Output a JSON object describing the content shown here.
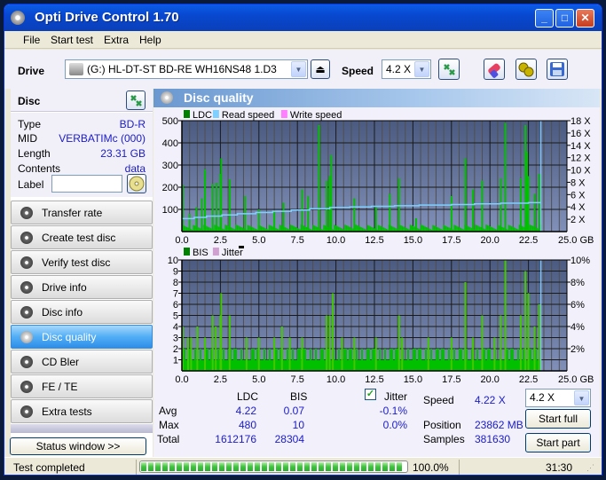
{
  "window": {
    "title": "Opti Drive Control 1.70",
    "controls": [
      "_",
      "□",
      "✕"
    ]
  },
  "menu": [
    "File",
    "Start test",
    "Extra",
    "Help"
  ],
  "toolbar": {
    "drive_label": "Drive",
    "drive_value": "(G:)  HL-DT-ST BD-RE  WH16NS48 1.D3",
    "speed_label": "Speed",
    "speed_value": "4.2 X",
    "icons": [
      "refresh-icon",
      "erase-icon",
      "settings-icon",
      "save-icon"
    ]
  },
  "disc": {
    "header": "Disc",
    "rows": [
      {
        "key": "Type",
        "value": "BD-R"
      },
      {
        "key": "MID",
        "value": "VERBATIMc (000)"
      },
      {
        "key": "Length",
        "value": "23.31 GB"
      },
      {
        "key": "Contents",
        "value": "data"
      }
    ],
    "label_key": "Label",
    "label_value": ""
  },
  "nav": [
    {
      "label": "Transfer rate",
      "active": false
    },
    {
      "label": "Create test disc",
      "active": false
    },
    {
      "label": "Verify test disc",
      "active": false
    },
    {
      "label": "Drive info",
      "active": false
    },
    {
      "label": "Disc info",
      "active": false
    },
    {
      "label": "Disc quality",
      "active": true
    },
    {
      "label": "CD Bler",
      "active": false
    },
    {
      "label": "FE / TE",
      "active": false
    },
    {
      "label": "Extra tests",
      "active": false
    }
  ],
  "status_window_button": "Status window >>",
  "panel_title": "Disc quality",
  "colors": {
    "ldc": "#00c000",
    "bis": "#00c000",
    "read_speed": "#80d0ff",
    "write_speed": "#ff80ff",
    "jitter": "#d0a0d0",
    "plot_bg_top": "#4a5a80",
    "plot_bg_bottom": "#8090b8",
    "value_text": "#1a1acc"
  },
  "chart_data": [
    {
      "type": "bar",
      "title": "LDC / Read speed",
      "legend": [
        "LDC",
        "Read speed",
        "Write speed"
      ],
      "legend_position": "top-left",
      "xlabel": "GB",
      "x_ticks": [
        "0.0",
        "2.5",
        "5.0",
        "7.5",
        "10.0",
        "12.5",
        "15.0",
        "17.5",
        "20.0",
        "22.5",
        "25.0 GB"
      ],
      "xlim": [
        0,
        25
      ],
      "y_left_ticks": [
        "100",
        "200",
        "300",
        "400",
        "500"
      ],
      "ylim_left": [
        0,
        500
      ],
      "y_right_ticks": [
        "2 X",
        "4 X",
        "6 X",
        "8 X",
        "10 X",
        "12 X",
        "14 X",
        "16 X",
        "18 X"
      ],
      "ylim_right": [
        0,
        18
      ],
      "grid": true,
      "end_position_gb": 23.31,
      "ldc_spikes": [
        {
          "x": 0.05,
          "y": 210
        },
        {
          "x": 0.5,
          "y": 80
        },
        {
          "x": 0.95,
          "y": 110
        },
        {
          "x": 1.3,
          "y": 150
        },
        {
          "x": 1.5,
          "y": 280
        },
        {
          "x": 2.0,
          "y": 215
        },
        {
          "x": 2.25,
          "y": 220
        },
        {
          "x": 2.5,
          "y": 260
        },
        {
          "x": 2.55,
          "y": 330
        },
        {
          "x": 3.1,
          "y": 235
        },
        {
          "x": 4.1,
          "y": 160
        },
        {
          "x": 5.0,
          "y": 100
        },
        {
          "x": 6.0,
          "y": 90
        },
        {
          "x": 6.6,
          "y": 130
        },
        {
          "x": 7.8,
          "y": 190
        },
        {
          "x": 8.2,
          "y": 160
        },
        {
          "x": 8.9,
          "y": 480
        },
        {
          "x": 9.4,
          "y": 230
        },
        {
          "x": 9.6,
          "y": 250
        },
        {
          "x": 9.7,
          "y": 345
        },
        {
          "x": 11.2,
          "y": 150
        },
        {
          "x": 12.6,
          "y": 110
        },
        {
          "x": 13.5,
          "y": 170
        },
        {
          "x": 14.1,
          "y": 240
        },
        {
          "x": 15.2,
          "y": 60
        },
        {
          "x": 17.5,
          "y": 160
        },
        {
          "x": 18.4,
          "y": 330
        },
        {
          "x": 18.9,
          "y": 190
        },
        {
          "x": 19.5,
          "y": 230
        },
        {
          "x": 20.7,
          "y": 240
        },
        {
          "x": 21.0,
          "y": 490
        },
        {
          "x": 22.0,
          "y": 240
        },
        {
          "x": 22.3,
          "y": 480
        },
        {
          "x": 22.4,
          "y": 360
        },
        {
          "x": 22.5,
          "y": 250
        },
        {
          "x": 22.9,
          "y": 170
        },
        {
          "x": 23.2,
          "y": 260
        }
      ],
      "ldc_baseline": 20,
      "read_speed": [
        {
          "x": 0.0,
          "y": 2.1
        },
        {
          "x": 0.8,
          "y": 2.3
        },
        {
          "x": 1.6,
          "y": 2.5
        },
        {
          "x": 2.6,
          "y": 2.7
        },
        {
          "x": 3.6,
          "y": 2.9
        },
        {
          "x": 4.8,
          "y": 3.1
        },
        {
          "x": 5.9,
          "y": 3.3
        },
        {
          "x": 7.1,
          "y": 3.5
        },
        {
          "x": 8.3,
          "y": 3.7
        },
        {
          "x": 9.6,
          "y": 3.9
        },
        {
          "x": 10.9,
          "y": 4.0
        },
        {
          "x": 12.3,
          "y": 4.1
        },
        {
          "x": 13.8,
          "y": 4.2
        },
        {
          "x": 15.4,
          "y": 4.3
        },
        {
          "x": 17.5,
          "y": 4.4
        },
        {
          "x": 19.0,
          "y": 4.5
        },
        {
          "x": 20.7,
          "y": 4.6
        },
        {
          "x": 22.5,
          "y": 4.7
        },
        {
          "x": 23.31,
          "y": 4.7
        }
      ]
    },
    {
      "type": "bar",
      "title": "BIS / Jitter",
      "legend": [
        "BIS",
        "Jitter"
      ],
      "legend_position": "top-left",
      "xlabel": "GB",
      "x_ticks": [
        "0.0",
        "2.5",
        "5.0",
        "7.5",
        "10.0",
        "12.5",
        "15.0",
        "17.5",
        "20.0",
        "22.5",
        "25.0 GB"
      ],
      "xlim": [
        0,
        25
      ],
      "y_left_ticks": [
        "1",
        "2",
        "3",
        "4",
        "5",
        "6",
        "7",
        "8",
        "9",
        "10"
      ],
      "ylim_left": [
        0,
        10
      ],
      "y_right_ticks": [
        "2%",
        "4%",
        "6%",
        "8%",
        "10%"
      ],
      "ylim_right": [
        0,
        10
      ],
      "grid": true,
      "end_position_gb": 23.31,
      "bis_spikes": [
        {
          "x": 0.05,
          "y": 4
        },
        {
          "x": 0.4,
          "y": 3
        },
        {
          "x": 0.6,
          "y": 3
        },
        {
          "x": 1.0,
          "y": 4
        },
        {
          "x": 1.5,
          "y": 3
        },
        {
          "x": 2.0,
          "y": 5
        },
        {
          "x": 2.2,
          "y": 4
        },
        {
          "x": 2.5,
          "y": 5
        },
        {
          "x": 2.55,
          "y": 7
        },
        {
          "x": 3.1,
          "y": 5
        },
        {
          "x": 4.2,
          "y": 3
        },
        {
          "x": 5.0,
          "y": 3
        },
        {
          "x": 6.0,
          "y": 3
        },
        {
          "x": 6.5,
          "y": 4
        },
        {
          "x": 7.0,
          "y": 3
        },
        {
          "x": 7.8,
          "y": 3
        },
        {
          "x": 9.4,
          "y": 5
        },
        {
          "x": 9.6,
          "y": 5
        },
        {
          "x": 9.8,
          "y": 7
        },
        {
          "x": 10.4,
          "y": 3
        },
        {
          "x": 11.2,
          "y": 3
        },
        {
          "x": 12.6,
          "y": 3
        },
        {
          "x": 14.1,
          "y": 5
        },
        {
          "x": 14.3,
          "y": 3
        },
        {
          "x": 16.0,
          "y": 3
        },
        {
          "x": 17.5,
          "y": 3
        },
        {
          "x": 18.4,
          "y": 8
        },
        {
          "x": 18.9,
          "y": 3
        },
        {
          "x": 19.5,
          "y": 5
        },
        {
          "x": 20.3,
          "y": 3
        },
        {
          "x": 20.7,
          "y": 5
        },
        {
          "x": 21.0,
          "y": 10
        },
        {
          "x": 22.0,
          "y": 5
        },
        {
          "x": 22.3,
          "y": 9
        },
        {
          "x": 22.5,
          "y": 7
        },
        {
          "x": 22.9,
          "y": 4
        },
        {
          "x": 23.2,
          "y": 6
        }
      ],
      "bis_baseline": 1,
      "bis_band_level": 2
    }
  ],
  "stats": {
    "col_ldc": "LDC",
    "col_bis": "BIS",
    "jitter_label": "Jitter",
    "jitter_checked": true,
    "rows": [
      {
        "label": "Avg",
        "ldc": "4.22",
        "bis": "0.07",
        "jitter": "-0.1%"
      },
      {
        "label": "Max",
        "ldc": "480",
        "bis": "10",
        "jitter": "0.0%"
      },
      {
        "label": "Total",
        "ldc": "1612176",
        "bis": "28304",
        "jitter": ""
      }
    ],
    "speed_label": "Speed",
    "speed_value": "4.22 X",
    "position_label": "Position",
    "position_value": "23862 MB",
    "samples_label": "Samples",
    "samples_value": "381630",
    "speed_select": "4.2 X",
    "start_full": "Start full",
    "start_part": "Start part"
  },
  "statusbar": {
    "text": "Test completed",
    "progress_percent": 100.0,
    "progress_text": "100.0%",
    "time": "31:30"
  }
}
